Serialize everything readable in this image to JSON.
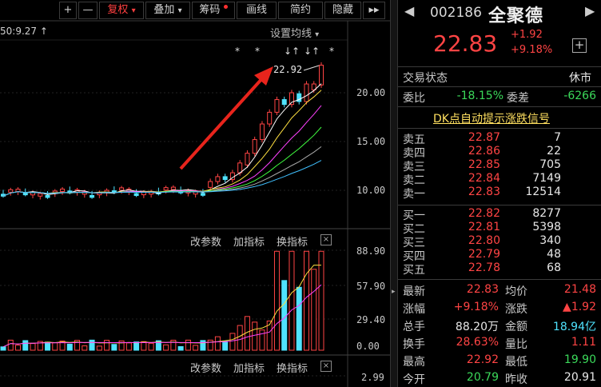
{
  "toolbar": {
    "plus": "+",
    "minus": "—",
    "fuquan": "复权",
    "fuquan_arrow": "▾",
    "diejia": "叠加",
    "diejia_arrow": "▾",
    "chouma": "筹码",
    "xianxian": "画线",
    "jianyue": "简约",
    "yincang": "隐藏",
    "more": "▸▸"
  },
  "main_chart": {
    "ma_text": "50:9.27 ↑",
    "setting_label": "设置均线",
    "setting_arrow": "▾",
    "star_icons": [
      "*",
      "*",
      "↓↑",
      "↓↑",
      "*"
    ],
    "high_label": "22.92",
    "yaxis": [
      "20.00",
      "15.00",
      "10.00"
    ]
  },
  "volume_panel": {
    "modify_params": "改参数",
    "add_indicator": "加指标",
    "switch_indicator": "换指标",
    "close": "×",
    "yaxis": [
      "88.90",
      "57.90",
      "29.40",
      "0.00"
    ]
  },
  "third_panel": {
    "modify_params": "改参数",
    "add_indicator": "加指标",
    "switch_indicator": "换指标",
    "close": "×",
    "yaxis": [
      "2.99"
    ]
  },
  "quote": {
    "prev_icon": "◀",
    "next_icon": "▶",
    "code": "002186",
    "name": "全聚德",
    "price": "22.83",
    "change": "+1.92",
    "change_pct": "+9.18%",
    "add_icon": "+",
    "status_label": "交易状态",
    "status_value": "休市",
    "weibi_label": "委比",
    "weibi_value": "-18.15%",
    "weicha_label": "委差",
    "weicha_value": "-6266",
    "dk_title": "DK点自动提示涨跌信号",
    "sell": [
      {
        "label": "卖五",
        "price": "22.87",
        "vol": "7"
      },
      {
        "label": "卖四",
        "price": "22.86",
        "vol": "22"
      },
      {
        "label": "卖三",
        "price": "22.85",
        "vol": "705"
      },
      {
        "label": "卖二",
        "price": "22.84",
        "vol": "7149"
      },
      {
        "label": "卖一",
        "price": "22.83",
        "vol": "12514"
      }
    ],
    "buy": [
      {
        "label": "买一",
        "price": "22.82",
        "vol": "8277"
      },
      {
        "label": "买二",
        "price": "22.81",
        "vol": "5398"
      },
      {
        "label": "买三",
        "price": "22.80",
        "vol": "340"
      },
      {
        "label": "买四",
        "price": "22.79",
        "vol": "48"
      },
      {
        "label": "买五",
        "price": "22.78",
        "vol": "68"
      }
    ],
    "stats": [
      {
        "l1": "最新",
        "v1": "22.83",
        "l2": "均价",
        "v2": "21.48"
      },
      {
        "l1": "涨幅",
        "v1": "+9.18%",
        "l2": "涨跌",
        "v2": "▲1.92"
      },
      {
        "l1": "总手",
        "v1": "88.20万",
        "l2": "金额",
        "v2": "18.94亿"
      },
      {
        "l1": "换手",
        "v1": "28.63%",
        "l2": "量比",
        "v2": "1.11"
      },
      {
        "l1": "最高",
        "v1": "22.92",
        "l2": "最低",
        "v2": "19.90"
      },
      {
        "l1": "今开",
        "v1": "20.79",
        "l2": "昨收",
        "v2": "20.91"
      }
    ]
  },
  "colors": {
    "up": "#ff4444",
    "down": "#4fe3ff",
    "green_text": "#3bd95a",
    "arrow": "#e8241c"
  }
}
